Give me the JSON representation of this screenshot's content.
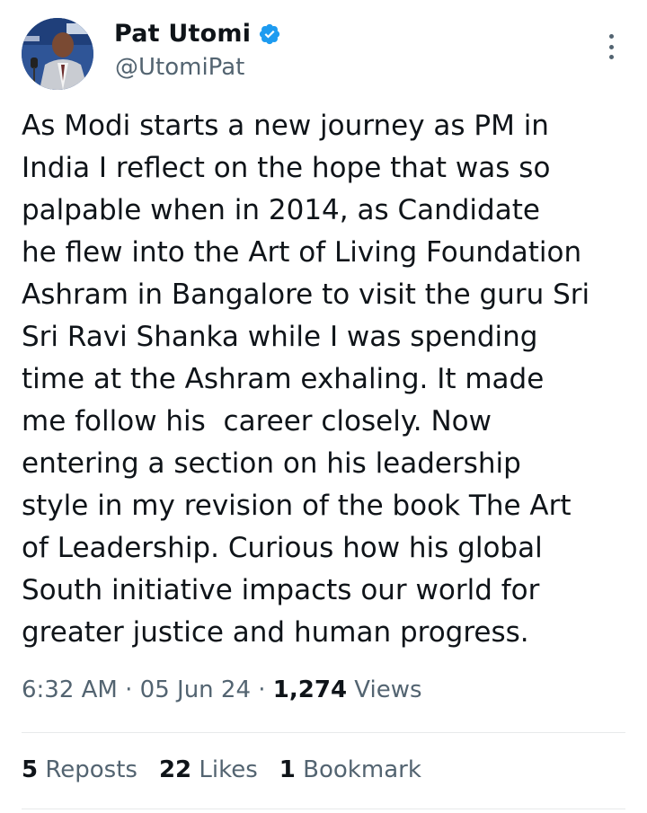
{
  "author": {
    "display_name": "Pat Utomi",
    "handle": "@UtomiPat",
    "verified": true,
    "verified_color": "#1d9bf0"
  },
  "tweet": {
    "lines": [
      "As Modi starts a new journey as PM in",
      "India I reflect on the hope that was so",
      "palpable when in 2014, as Candidate",
      "he flew into the Art of Living Foundation",
      "Ashram in Bangalore to visit the guru Sri",
      "Sri Ravi Shanka while I was spending",
      "time at the Ashram exhaling. It made",
      "me follow his  career closely. Now",
      "entering a section on his leadership",
      "style in my revision of the book The Art",
      "of Leadership. Curious how his global",
      "South initiative impacts our world for",
      "greater justice and human progress."
    ]
  },
  "meta": {
    "time": "6:32 AM",
    "separator": " · ",
    "date": "05 Jun 24",
    "views_count": "1,274",
    "views_label": " Views"
  },
  "stats": {
    "reposts_count": "5",
    "reposts_label": " Reposts",
    "likes_count": "22",
    "likes_label": " Likes",
    "bookmarks_count": "1",
    "bookmarks_label": " Bookmark"
  },
  "icons": {
    "avatar": "avatar-photo",
    "verified": "verified-badge-icon",
    "more": "more-options-icon"
  }
}
